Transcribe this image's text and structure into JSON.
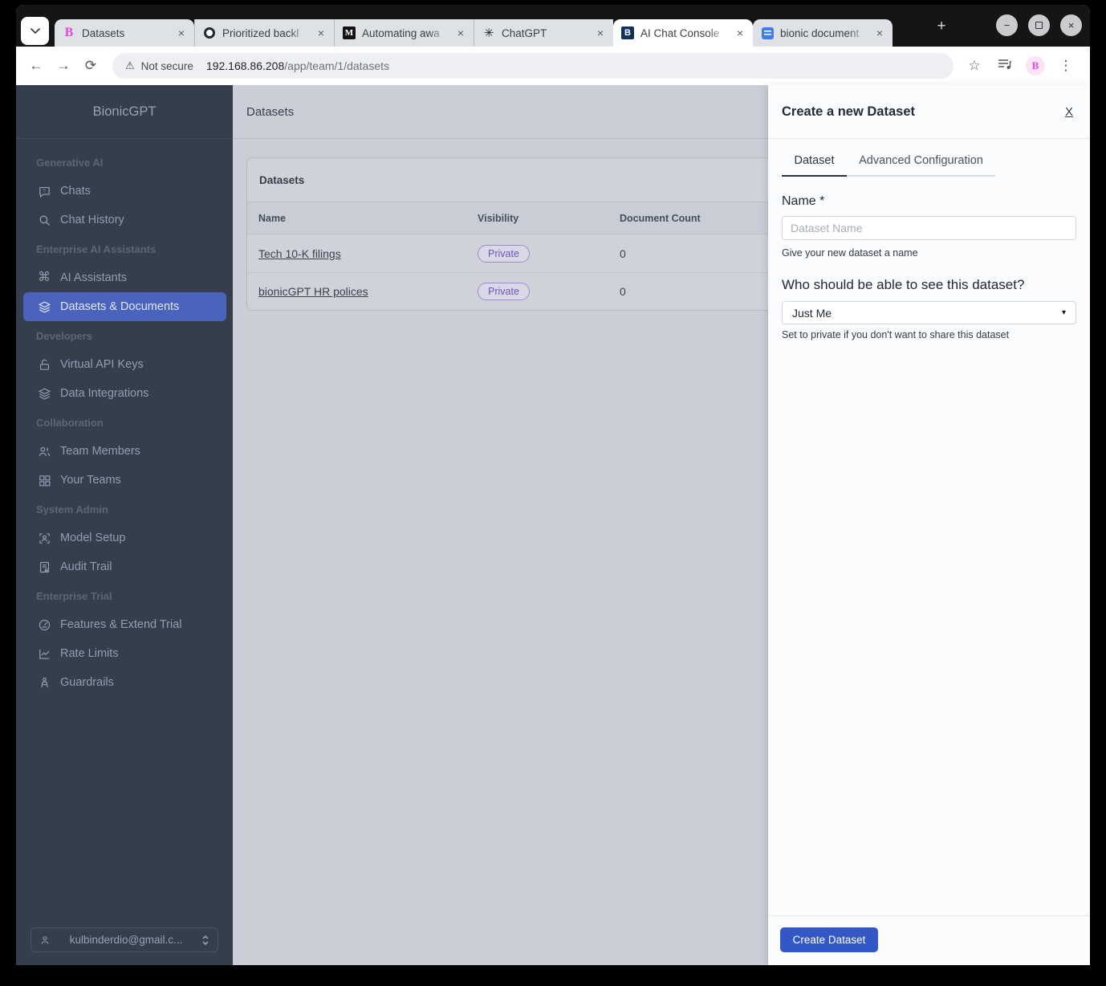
{
  "browser": {
    "tabs": [
      {
        "title": "Datasets",
        "favicon": "bionicgpt-pink-logo"
      },
      {
        "title": "Prioritized backl",
        "favicon": "github-logo"
      },
      {
        "title": "Automating awa",
        "favicon": "medium-logo"
      },
      {
        "title": "ChatGPT",
        "favicon": "chatgpt-logo"
      },
      {
        "title": "AI Chat Console",
        "favicon": "bionicgpt-navy-logo",
        "active": true
      },
      {
        "title": "bionic document",
        "favicon": "docs-logo"
      }
    ],
    "favicon_letters": {
      "bionic_pink": "B",
      "medium": "M",
      "bionic_navy": "B"
    },
    "address": {
      "security_label": "Not secure",
      "host": "192.168.86.208",
      "path": "/app/team/1/datasets"
    },
    "icons": {
      "back": "←",
      "forward": "→",
      "reload": "⟳",
      "warning": "⚠",
      "star": "☆",
      "more": "⋮",
      "new_tab": "+",
      "close_tab": "×",
      "minimize": "−",
      "close_window": "×",
      "extension_letter": "B",
      "chatgpt_glyph": "✳"
    }
  },
  "sidebar": {
    "brand": "BionicGPT",
    "sections": [
      {
        "label": "Generative AI",
        "items": [
          {
            "label": "Chats"
          },
          {
            "label": "Chat History"
          }
        ]
      },
      {
        "label": "Enterprise AI Assistants",
        "items": [
          {
            "label": "AI Assistants"
          },
          {
            "label": "Datasets & Documents",
            "active": true
          }
        ]
      },
      {
        "label": "Developers",
        "items": [
          {
            "label": "Virtual API Keys"
          },
          {
            "label": "Data Integrations"
          }
        ]
      },
      {
        "label": "Collaboration",
        "items": [
          {
            "label": "Team Members"
          },
          {
            "label": "Your Teams"
          }
        ]
      },
      {
        "label": "System Admin",
        "items": [
          {
            "label": "Model Setup"
          },
          {
            "label": "Audit Trail"
          }
        ]
      },
      {
        "label": "Enterprise Trial",
        "items": [
          {
            "label": "Features & Extend Trial"
          },
          {
            "label": "Rate Limits"
          },
          {
            "label": "Guardrails"
          }
        ]
      }
    ],
    "command_glyph": "⌘",
    "user_email": "kulbinderdio@gmail.c..."
  },
  "main": {
    "page_title": "Datasets",
    "card_title": "Datasets",
    "table": {
      "columns": [
        "Name",
        "Visibility",
        "Document Count"
      ],
      "rows": [
        {
          "name": "Tech 10-K filings",
          "visibility": "Private",
          "document_count": "0"
        },
        {
          "name": "bionicGPT HR polices",
          "visibility": "Private",
          "document_count": "0"
        }
      ]
    }
  },
  "panel": {
    "title": "Create a new Dataset",
    "close_label": "X",
    "tabs": [
      {
        "label": "Dataset",
        "active": true
      },
      {
        "label": "Advanced Configuration",
        "active": false
      }
    ],
    "name_label": "Name *",
    "name_placeholder": "Dataset Name",
    "name_help": "Give your new dataset a name",
    "visibility_label": "Who should be able to see this dataset?",
    "visibility_value": "Just Me",
    "visibility_caret": "▾",
    "visibility_help": "Set to private if you don't want to share this dataset",
    "submit_label": "Create Dataset"
  },
  "colors": {
    "sidebar_bg": "#353e4d",
    "sidebar_active_bg": "#4a63bd",
    "main_overlay_bg": "#cbced6",
    "panel_bg": "#fbfcfd",
    "primary_button": "#3457c8",
    "badge_text": "#6f55b5",
    "badge_border": "#9e8bcd",
    "brand_pink": "#e14ae0"
  }
}
